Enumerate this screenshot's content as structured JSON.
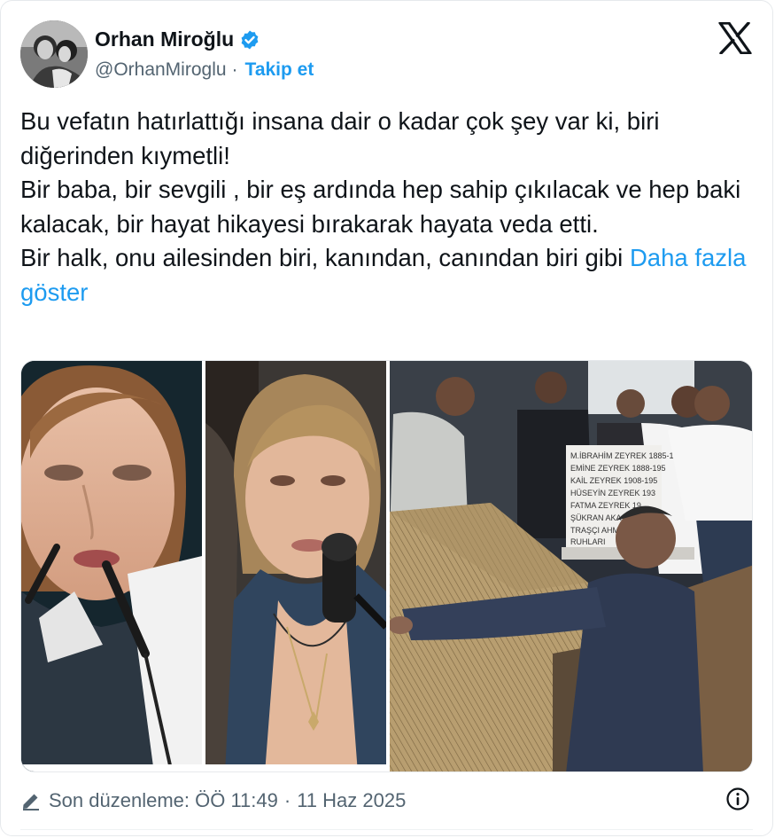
{
  "author": {
    "name": "Orhan Miroğlu",
    "handle": "@OrhanMiroglu",
    "separator": "·",
    "follow_label": "Takip et"
  },
  "post": {
    "paragraphs": [
      "Bu vefatın hatırlattığı insana dair o kadar çok şey var ki, biri diğerinden kıymetli!",
      "Bir baba, bir sevgili , bir eş ardında hep sahip çıkılacak ve hep baki kalacak, bir hayat hikayesi bırakarak hayata veda etti.",
      "Bir halk, onu ailesinden biri, kanından, canından biri gibi"
    ],
    "show_more": "Daha fazla göster"
  },
  "headstone_lines": [
    "M.İBRAHİM ZEYREK 1885-19",
    "EMİNE ZEYREK 1888-195",
    "KAİL ZEYREK 1908-195",
    "HÜSEYİN ZEYREK 193",
    "FATMA ZEYREK 19",
    "ŞÜKRAN AKA",
    "TRAŞÇI AHM",
    "RUHLARI"
  ],
  "footer": {
    "edited_label": "Son düzenleme: ÖÖ 11:49",
    "separator": "·",
    "date": "11 Haz 2025"
  },
  "icons": [
    "verified-badge-icon",
    "x-logo-icon",
    "pencil-icon",
    "info-icon"
  ],
  "colors": {
    "accent": "#1d9bf0",
    "text": "#0f1419",
    "secondary": "#536471"
  }
}
